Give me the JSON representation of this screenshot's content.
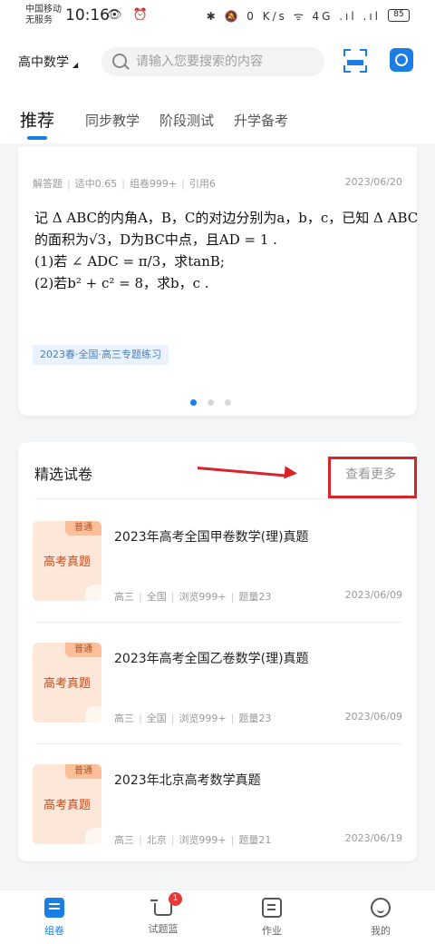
{
  "status_bar": {
    "carrier_line1": "中国移动",
    "carrier_line2": "无服务",
    "time": "10:16",
    "left_icons": "👁 ⏰",
    "right_icons": "✱ 🔕 0 K/s ᯤ 4G .ıl .ıl",
    "battery": "85"
  },
  "header": {
    "subject": "高中数学",
    "search_placeholder": "请输入您要搜索的内容",
    "scan_icon": "scan-icon",
    "camera_icon": "camera-icon",
    "accent_color": "#1a7ee6"
  },
  "tabs": [
    {
      "label": "推荐",
      "active": true
    },
    {
      "label": "同步教学",
      "active": false
    },
    {
      "label": "阶段测试",
      "active": false
    },
    {
      "label": "升学备考",
      "active": false
    }
  ],
  "question_card": {
    "meta": [
      "解答题",
      "适中0.65",
      "组卷999+",
      "引用6"
    ],
    "date": "2023/06/20",
    "lines": [
      "记 Δ ABC的内角A，B，C的对边分别为a，b，c，已知 Δ ABC",
      "的面积为√3，D为BC中点，且AD = 1 .",
      "(1)若 ∠ ADC = π/3，求tanB;",
      "(2)若b² + c² = 8，求b，c ."
    ],
    "tag": "2023春·全国·高三专题练习",
    "carousel_dots": 3,
    "active_dot": 0
  },
  "papers_section": {
    "title": "精选试卷",
    "more_label": "查看更多",
    "items": [
      {
        "badge": "普通",
        "thumb_label": "高考真题",
        "title": "2023年高考全国甲卷数学(理)真题",
        "meta": [
          "高三",
          "全国",
          "浏览999+",
          "题量23"
        ],
        "date": "2023/06/09"
      },
      {
        "badge": "普通",
        "thumb_label": "高考真题",
        "title": "2023年高考全国乙卷数学(理)真题",
        "meta": [
          "高三",
          "全国",
          "浏览999+",
          "题量23"
        ],
        "date": "2023/06/09"
      },
      {
        "badge": "普通",
        "thumb_label": "高考真题",
        "title": "2023年北京高考数学真题",
        "meta": [
          "高三",
          "北京",
          "浏览999+",
          "题量21"
        ],
        "date": "2023/06/19"
      }
    ]
  },
  "bottom_nav": [
    {
      "label": "组卷",
      "icon": "compose-icon",
      "active": true
    },
    {
      "label": "试题篮",
      "icon": "basket-icon",
      "active": false,
      "badge": "1"
    },
    {
      "label": "作业",
      "icon": "homework-icon",
      "active": false
    },
    {
      "label": "我的",
      "icon": "profile-icon",
      "active": false
    }
  ]
}
